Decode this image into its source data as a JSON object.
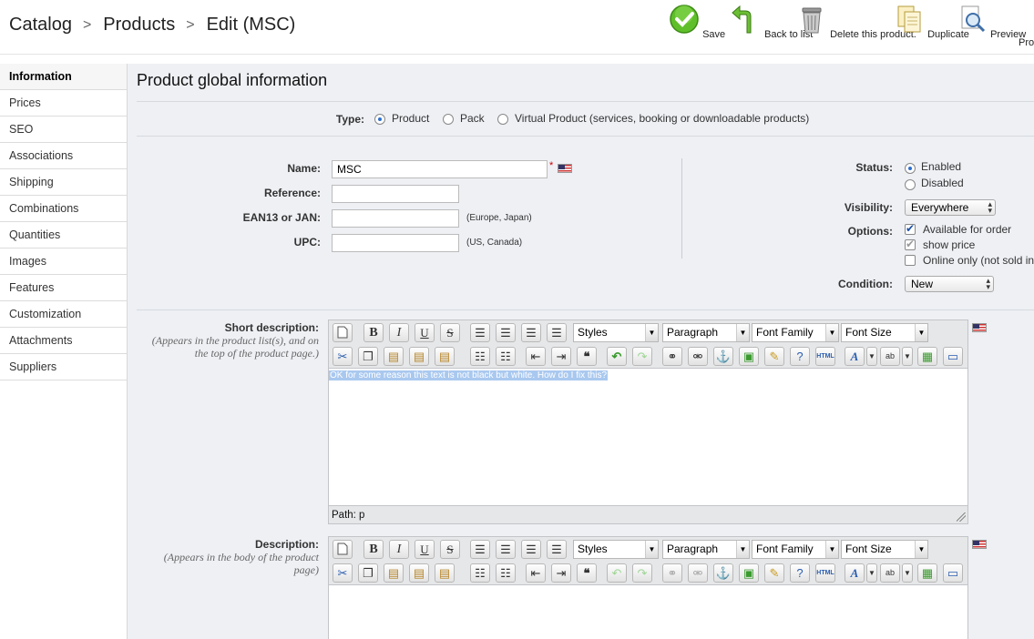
{
  "breadcrumb": [
    "Catalog",
    "Products",
    "Edit (MSC)"
  ],
  "toolbar": {
    "save": "Save",
    "back": "Back to list",
    "delete": "Delete this product.",
    "duplicate": "Duplicate",
    "preview": "Preview",
    "more": "Pro"
  },
  "sidebar": {
    "items": [
      "Information",
      "Prices",
      "SEO",
      "Associations",
      "Shipping",
      "Combinations",
      "Quantities",
      "Images",
      "Features",
      "Customization",
      "Attachments",
      "Suppliers"
    ]
  },
  "page_title": "Product global information",
  "type": {
    "label": "Type:",
    "options": [
      "Product",
      "Pack",
      "Virtual Product (services, booking or downloadable products)"
    ],
    "selected": "Product"
  },
  "fields": {
    "name_label": "Name:",
    "name_value": "MSC",
    "required_mark": "*",
    "reference_label": "Reference:",
    "ean_label": "EAN13 or JAN:",
    "ean_hint": "(Europe, Japan)",
    "upc_label": "UPC:",
    "upc_hint": "(US, Canada)"
  },
  "status": {
    "label": "Status:",
    "enabled": "Enabled",
    "disabled": "Disabled"
  },
  "visibility": {
    "label": "Visibility:",
    "value": "Everywhere"
  },
  "options": {
    "label": "Options:",
    "available": "Available for order",
    "show_price": "show price",
    "online_only": "Online only (not sold in"
  },
  "condition": {
    "label": "Condition:",
    "value": "New"
  },
  "short_description": {
    "label": "Short description:",
    "note": "(Appears in the product list(s), and on the top of the product page.)",
    "content": "OK for some reason this text is not black but white. How do I fix this?",
    "path": "Path: p"
  },
  "description": {
    "label": "Description:",
    "note": "(Appears in the body of the product page)"
  },
  "editor_dropdowns": {
    "styles": "Styles",
    "paragraph": "Paragraph",
    "font_family": "Font Family",
    "font_size": "Font Size"
  }
}
